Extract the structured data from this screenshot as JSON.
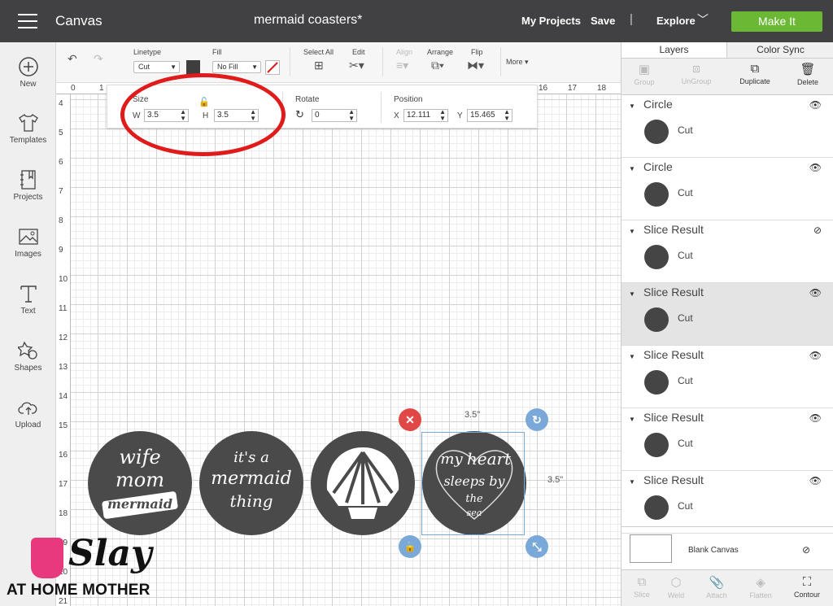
{
  "topbar": {
    "app_title": "Canvas",
    "doc_title": "mermaid coasters*",
    "my_projects": "My Projects",
    "save": "Save",
    "separator": "|",
    "explore": "Explore",
    "make_it": "Make It",
    "make_it_color": "#6bb834"
  },
  "sidebar": {
    "items": [
      {
        "label": "New",
        "icon": "plus-circle-icon"
      },
      {
        "label": "Templates",
        "icon": "tshirt-icon"
      },
      {
        "label": "Projects",
        "icon": "notebook-icon"
      },
      {
        "label": "Images",
        "icon": "image-icon"
      },
      {
        "label": "Text",
        "icon": "text-t-icon"
      },
      {
        "label": "Shapes",
        "icon": "shapes-icon"
      },
      {
        "label": "Upload",
        "icon": "cloud-upload-icon"
      }
    ]
  },
  "toolbar": {
    "linetype_label": "Linetype",
    "linetype_value": "Cut",
    "fill_label": "Fill",
    "fill_value": "No Fill",
    "select_all": "Select All",
    "edit": "Edit",
    "align": "Align",
    "arrange": "Arrange",
    "flip": "Flip",
    "more": "More"
  },
  "size_popup": {
    "size_label": "Size",
    "w_label": "W",
    "w_value": "3.5",
    "h_label": "H",
    "h_value": "3.5",
    "rotate_label": "Rotate",
    "rotate_value": "0",
    "position_label": "Position",
    "x_label": "X",
    "x_value": "12.111",
    "y_label": "Y",
    "y_value": "15.465"
  },
  "rulers": {
    "top": [
      "0",
      "1",
      "16",
      "17",
      "18"
    ],
    "left": [
      "4",
      "5",
      "6",
      "7",
      "8",
      "9",
      "10",
      "11",
      "12",
      "13",
      "14",
      "15",
      "16",
      "17",
      "18",
      "19",
      "20",
      "21"
    ]
  },
  "canvas": {
    "coasters": [
      {
        "text_lines": [
          "wife",
          "mom",
          "mermaid"
        ]
      },
      {
        "text_lines": [
          "it's a",
          "mermaid",
          "thing"
        ]
      },
      {
        "text_lines": [
          "shell"
        ]
      },
      {
        "text_lines": [
          "my",
          "heart",
          "sleeps by",
          "the",
          "sea"
        ]
      }
    ],
    "selection_width": "3.5\"",
    "selection_height": "3.5\""
  },
  "layers_panel": {
    "tabs": [
      "Layers",
      "Color Sync"
    ],
    "actions": [
      "Group",
      "UnGroup",
      "Duplicate",
      "Delete"
    ],
    "layers": [
      {
        "name": "Circle",
        "op": "Cut",
        "visible": true,
        "selected": false
      },
      {
        "name": "Circle",
        "op": "Cut",
        "visible": true,
        "selected": false
      },
      {
        "name": "Slice Result",
        "op": "Cut",
        "visible": false,
        "selected": false
      },
      {
        "name": "Slice Result",
        "op": "Cut",
        "visible": true,
        "selected": true
      },
      {
        "name": "Slice Result",
        "op": "Cut",
        "visible": true,
        "selected": false
      },
      {
        "name": "Slice Result",
        "op": "Cut",
        "visible": true,
        "selected": false
      },
      {
        "name": "Slice Result",
        "op": "Cut",
        "visible": true,
        "selected": false
      }
    ],
    "blank_canvas": "Blank Canvas",
    "bottom_actions": [
      "Slice",
      "Weld",
      "Attach",
      "Flatten",
      "Contour"
    ]
  },
  "watermark": {
    "brand_top": "Slay",
    "brand_bottom": "AT HOME MOTHER"
  }
}
